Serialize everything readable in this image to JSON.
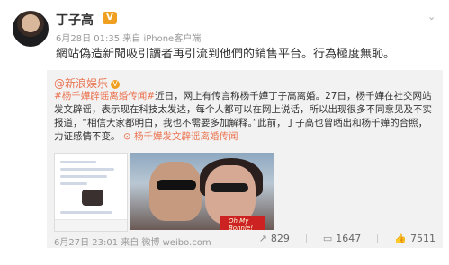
{
  "post": {
    "username": "丁子高",
    "meta": "6月28日 01:35 来自 iPhone客户端",
    "text": "網站偽造新聞吸引讀者再引流到他們的銷售平台。行為極度無恥。"
  },
  "repost": {
    "author": "@新浪娱乐",
    "hashtag": "#杨千嬅辟谣离婚传闻#",
    "text": "近日，网上有传言称杨千嬅丁子高离婚。27日，杨千嬅在社交网站发文辟谣，表示现在科技太发达，每个人都可以在网上说话，所以出现很多不同意见及不实报道，“相信大家都明白，我也不需要多加解释。”此前，丁子高也曾晒出和杨千嬅的合照，力证感情不变。",
    "topic_link": "杨千嬅发文辟谣离婚传闻",
    "shirt_text": "Oh My Bonnie!",
    "foot": "6月27日 23:01 来自 微博 weibo.com",
    "stats": {
      "share": "829",
      "comment": "1647",
      "like": "7511"
    }
  },
  "icons": {
    "share": "share-icon",
    "comment": "comment-icon",
    "like": "like-icon",
    "expand": "chevron-down-icon"
  },
  "colors": {
    "link": "#eb7350",
    "vip": "#f0a020"
  }
}
